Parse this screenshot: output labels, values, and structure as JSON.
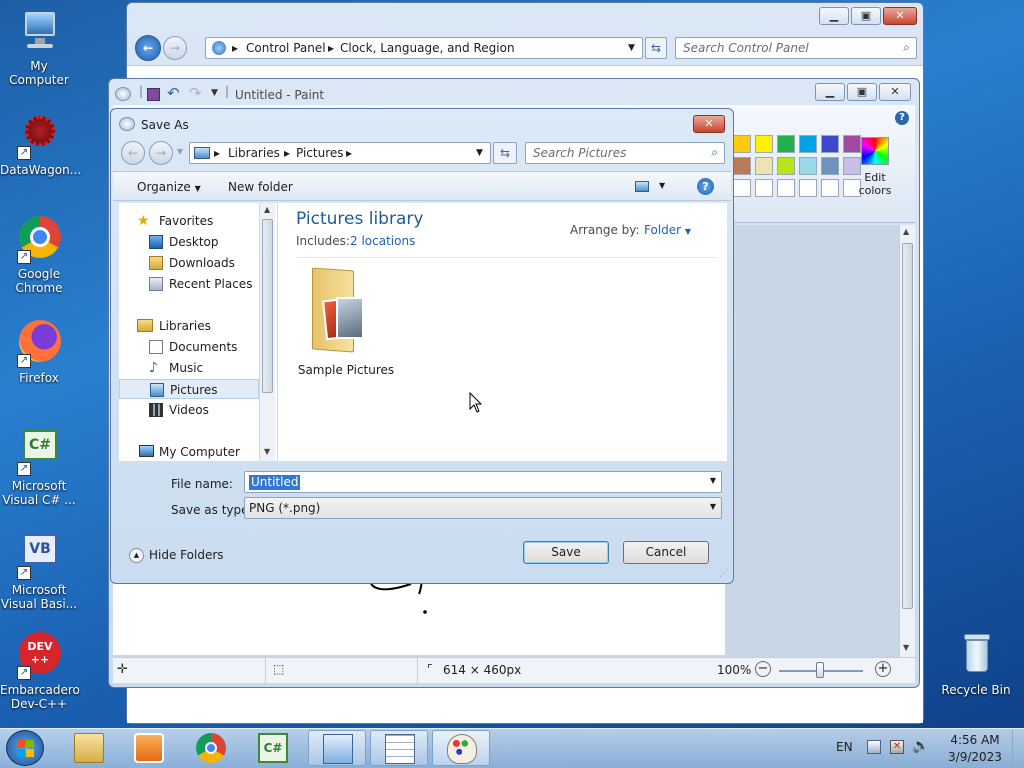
{
  "desktop": {
    "icons": [
      {
        "label": "My Computer"
      },
      {
        "label": "DataWagon..."
      },
      {
        "label": "Google\nChrome"
      },
      {
        "label": "Firefox"
      },
      {
        "label": "Microsoft\nVisual C# ..."
      },
      {
        "label": "Microsoft\nVisual Basi..."
      },
      {
        "label": "Embarcadero\nDev-C++"
      },
      {
        "label": "Recycle Bin"
      }
    ]
  },
  "control_panel": {
    "breadcrumb": [
      "Control Panel",
      "Clock, Language, and Region"
    ],
    "search_placeholder": "Search Control Panel"
  },
  "paint": {
    "title": "Untitled - Paint",
    "edit_colors_label": "Edit\ncolors",
    "status": {
      "dimensions": "614 × 460px",
      "zoom": "100%"
    }
  },
  "save_as": {
    "title": "Save As",
    "breadcrumb": [
      "Libraries",
      "Pictures"
    ],
    "search_placeholder": "Search Pictures",
    "toolbar": {
      "organize": "Organize",
      "new_folder": "New folder"
    },
    "nav": {
      "favorites_header": "Favorites",
      "favorites": [
        "Desktop",
        "Downloads",
        "Recent Places"
      ],
      "libraries_header": "Libraries",
      "libraries": [
        "Documents",
        "Music",
        "Pictures",
        "Videos"
      ],
      "computer": "My Computer"
    },
    "library_title": "Pictures library",
    "includes_label": "Includes:",
    "includes_link": "2 locations",
    "arrange_label": "Arrange by:",
    "arrange_value": "Folder",
    "items": [
      {
        "label": "Sample Pictures"
      }
    ],
    "file_name_label": "File name:",
    "file_name_value": "Untitled",
    "save_type_label": "Save as type:",
    "save_type_value": "PNG (*.png)",
    "hide_folders": "Hide Folders",
    "save_button": "Save",
    "cancel_button": "Cancel"
  },
  "taskbar": {
    "language": "EN",
    "time": "4:56 AM",
    "date": "3/9/2023"
  },
  "colors": {
    "palette_row1": [
      "#ffc90e",
      "#fff200",
      "#22b14c",
      "#00a2e8",
      "#3f48cc",
      "#a349a4"
    ],
    "palette_row2": [
      "#b97a57",
      "#efe4b0",
      "#b5e61d",
      "#99d9ea",
      "#7092be",
      "#c8bfe7"
    ]
  }
}
